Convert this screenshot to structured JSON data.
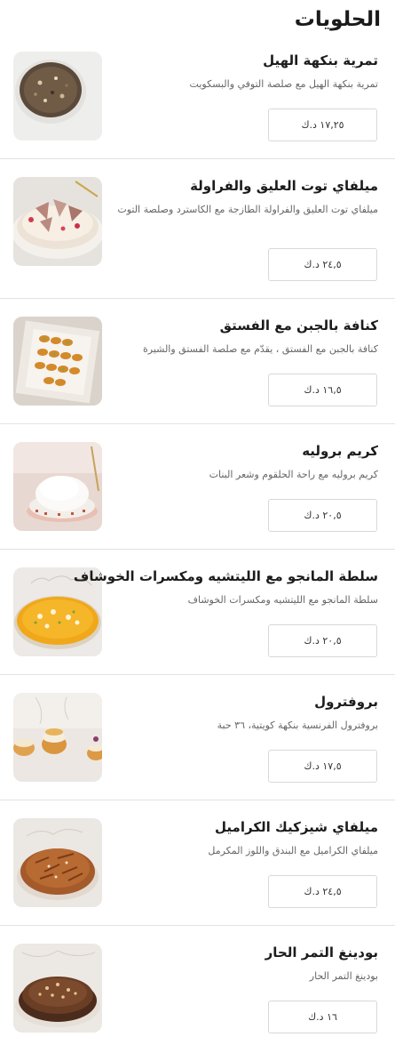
{
  "section_title": "الحلويات",
  "items": [
    {
      "name": "تمرية بنكهة الهيل",
      "description": "تمرية بنكهة الهيل مع صلصة التوفي والبسكويت",
      "price": "١٧,٢٥ د.ك",
      "image_icon": "date-pudding-image"
    },
    {
      "name": "ميلفاي توت العليق والفراولة",
      "description": "ميلفاي توت العليق والفراولة الطازجة مع الكاسترد وصلصة التوت",
      "price": "٢٤,٥ د.ك",
      "image_icon": "mille-feuille-image"
    },
    {
      "name": "كنافة بالجبن مع الفستق",
      "description": "كنافة بالجبن مع الفستق ، يقدّم مع صلصة الفستق والشيرة",
      "price": "١٦,٥ د.ك",
      "image_icon": "kunafa-image"
    },
    {
      "name": "كريم بروليه",
      "description": "كريم بروليه مع راحة الحلقوم وشعر البنات",
      "price": "٢٠,٥ د.ك",
      "image_icon": "creme-brulee-image"
    },
    {
      "name": "سلطة المانجو مع الليتشيه ومكسرات الخوشاف",
      "description": "سلطة المانجو مع الليتشيه ومكسرات الخوشاف",
      "price": "٢٠,٥ د.ك",
      "image_icon": "mango-salad-image"
    },
    {
      "name": "بروفترول",
      "description": "بروفترول الفرنسية بنكهة كويتية، ٣٦ حبة",
      "price": "١٧,٥ د.ك",
      "image_icon": "profiterole-image"
    },
    {
      "name": "ميلفاي شيزكيك الكراميل",
      "description": "ميلفاي الكراميل مع البندق واللوز المكرمل",
      "price": "٢٤,٥ د.ك",
      "image_icon": "caramel-cheesecake-image"
    },
    {
      "name": "بودينغ التمر الحار",
      "description": "بودينغ التمر الحار",
      "price": "١٦ د.ك",
      "image_icon": "sticky-date-pudding-image"
    }
  ]
}
